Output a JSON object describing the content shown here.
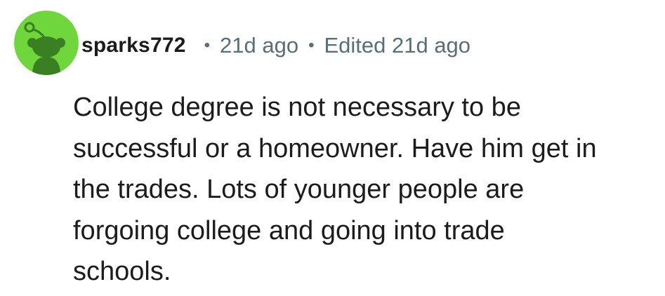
{
  "comment": {
    "username": "sparks772",
    "separator": "•",
    "posted": "21d ago",
    "edited": "Edited 21d ago",
    "avatar_icon": "snoo-avatar-icon",
    "avatar_color": "#6fd63c",
    "body_lines": [
      "College degree is not necessary to be",
      "successful or a homeowner. Have him get in",
      "the trades. Lots of younger people are",
      "forgoing college and going into trade",
      "schools."
    ]
  }
}
